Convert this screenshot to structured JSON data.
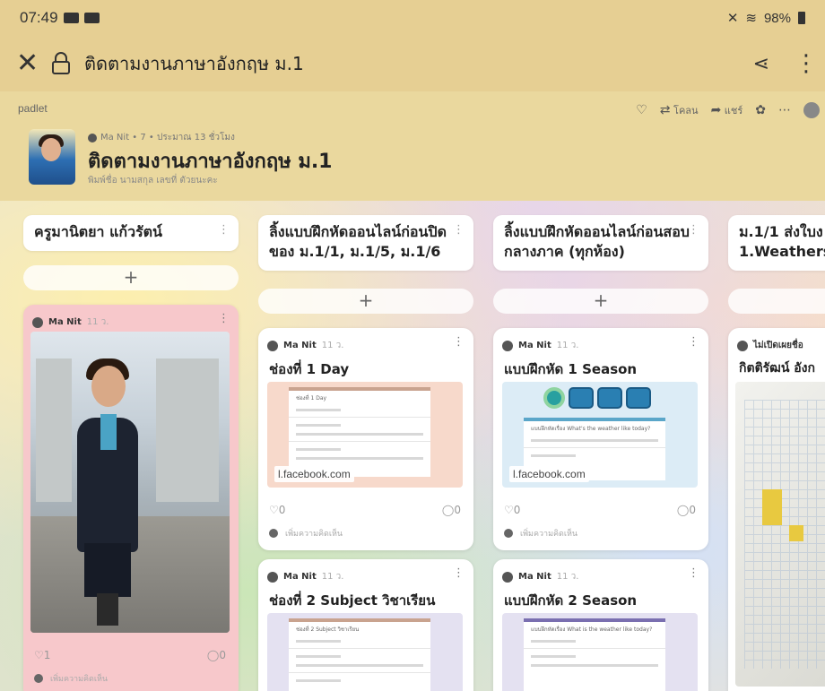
{
  "status": {
    "time": "07:49",
    "battery": "98%"
  },
  "browser": {
    "title": "ติดตามงานภาษาอังกฤษ ม.1"
  },
  "padlet": {
    "brand": "padlet",
    "toolbar": {
      "remake": "โคลน",
      "share": "แชร์"
    },
    "owner_meta": "Ma Nit • 7 • ประมาณ 13 ชั่วโมง",
    "title": "ติดตามงานภาษาอังกฤษ ม.1",
    "subtitle": "พิมพ์ชื่อ นามสกุล เลขที่ ตัวยนะคะ"
  },
  "columns": [
    {
      "title": "ครูมานิตยา แก้วรัตน์"
    },
    {
      "title": "ลิ้งแบบฝึกหัดออนไลน์ก่อนปิดของ ม.1/1, ม.1/5, ม.1/6"
    },
    {
      "title": "ลิ้งแบบฝึกหัดออนไลน์ก่อนสอบกลางภาค (ทุกห้อง)"
    },
    {
      "title": "ม.1/1 ส่งใบง 1.Weathers"
    }
  ],
  "add_label": "+",
  "cards": {
    "c1": {
      "author": "Ma Nit",
      "time": "11 ว.",
      "likes": "1",
      "comments": "0",
      "add_comment": "เพิ่มความคิดเห็น"
    },
    "c2a": {
      "author": "Ma Nit",
      "time": "11 ว.",
      "title": "ช่องที่ 1 Day",
      "link": "l.facebook.com",
      "form_title": "ช่องที่ 1 Day",
      "likes": "0",
      "comments": "0",
      "add_comment": "เพิ่มความคิดเห็น"
    },
    "c2b": {
      "author": "Ma Nit",
      "time": "11 ว.",
      "title": "ช่องที่ 2 Subject วิชาเรียน",
      "form_title": "ช่องที่ 2 Subject วิชาเรียน"
    },
    "c3a": {
      "author": "Ma Nit",
      "time": "11 ว.",
      "title": "แบบฝึกหัด 1 Season",
      "link": "l.facebook.com",
      "form_title": "แบบฝึกหัดเรื่อง What's the weather like today?",
      "likes": "0",
      "comments": "0",
      "add_comment": "เพิ่มความคิดเห็น"
    },
    "c3b": {
      "author": "Ma Nit",
      "time": "11 ว.",
      "title": "แบบฝึกหัด 2 Season",
      "form_title": "แบบฝึกหัดเรื่อง What is the weather like today?"
    },
    "c4a": {
      "author": "ไม่เปิดเผยชื่อ",
      "time": "",
      "title": "กิตติรัฒน์ อังก"
    }
  }
}
